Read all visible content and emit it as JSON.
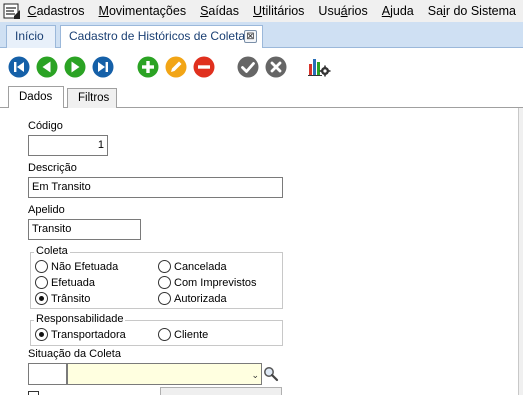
{
  "menu": {
    "items": [
      {
        "label_pre": "",
        "accel": "C",
        "label_post": "adastros"
      },
      {
        "label_pre": "",
        "accel": "M",
        "label_post": "ovimentações"
      },
      {
        "label_pre": "",
        "accel": "S",
        "label_post": "aídas"
      },
      {
        "label_pre": "",
        "accel": "U",
        "label_post": "tilitários"
      },
      {
        "label_pre": "Usu",
        "accel": "á",
        "label_post": "rios"
      },
      {
        "label_pre": "",
        "accel": "A",
        "label_post": "juda"
      },
      {
        "label_pre": "Sa",
        "accel": "i",
        "label_post": "r do Sistema"
      }
    ]
  },
  "doc_tabs": {
    "inicio": "Início",
    "cadastro": "Cadastro de Históricos de Coletas",
    "close_glyph": "⊠"
  },
  "toolbar": {
    "buttons": [
      {
        "name": "first-record-button",
        "icon": "skip-back-icon",
        "color": "#1560a8"
      },
      {
        "name": "previous-record-button",
        "icon": "play-back-icon",
        "color": "#2ba324"
      },
      {
        "name": "next-record-button",
        "icon": "play-forward-icon",
        "color": "#2ba324"
      },
      {
        "name": "last-record-button",
        "icon": "skip-forward-icon",
        "color": "#1560a8"
      },
      {
        "name": "add-button",
        "icon": "plus-icon",
        "color": "#2ba324"
      },
      {
        "name": "edit-button",
        "icon": "pencil-icon",
        "color": "#f2a516"
      },
      {
        "name": "delete-button",
        "icon": "minus-icon",
        "color": "#e0301e"
      },
      {
        "name": "confirm-button",
        "icon": "check-icon",
        "color": "#666666"
      },
      {
        "name": "cancel-button",
        "icon": "x-icon",
        "color": "#666666"
      },
      {
        "name": "report-button",
        "icon": "chart-gear-icon",
        "color": "#333333"
      }
    ]
  },
  "inner_tabs": {
    "dados": "Dados",
    "filtros": "Filtros"
  },
  "form": {
    "codigo_label": "Código",
    "codigo_value": "1",
    "descricao_label": "Descrição",
    "descricao_value": "Em Transito",
    "apelido_label": "Apelido",
    "apelido_value": "Transito",
    "coleta": {
      "title": "Coleta",
      "options": [
        {
          "label": "Não Efetuada",
          "checked": false
        },
        {
          "label": "Efetuada",
          "checked": false
        },
        {
          "label": "Trânsito",
          "checked": true
        },
        {
          "label": "Cancelada",
          "checked": false
        },
        {
          "label": "Com Imprevistos",
          "checked": false
        },
        {
          "label": "Autorizada",
          "checked": false
        }
      ]
    },
    "responsabilidade": {
      "title": "Responsabilidade",
      "options": [
        {
          "label": "Transportadora",
          "checked": true
        },
        {
          "label": "Cliente",
          "checked": false
        }
      ]
    },
    "situacao_label": "Situação da Coleta",
    "situacao_code": "",
    "situacao_value": "",
    "combo_arrow": "⌄",
    "combo_bg": "#ffffe0"
  }
}
